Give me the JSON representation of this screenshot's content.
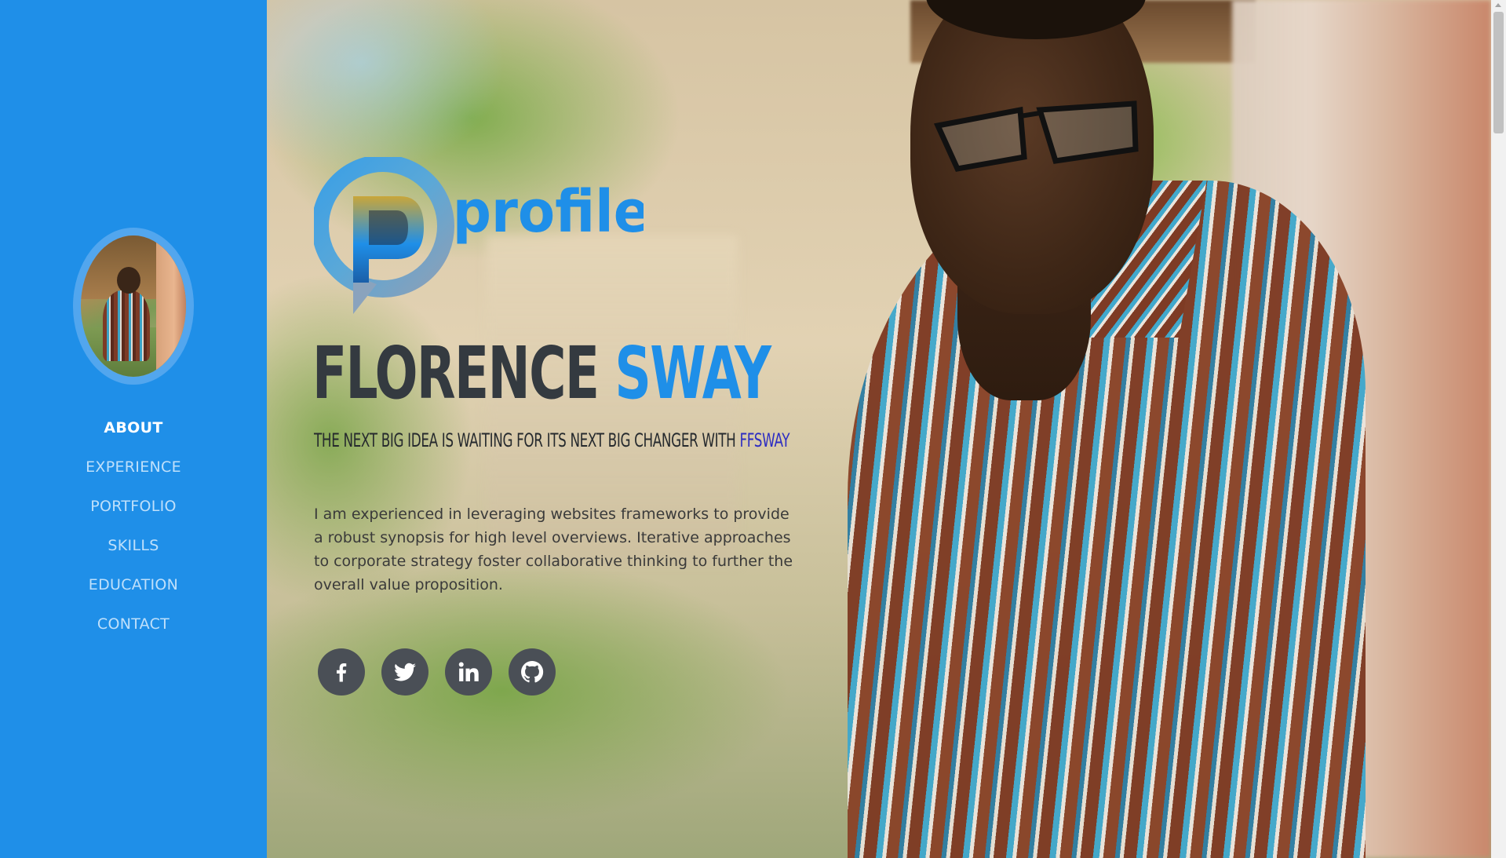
{
  "sidebar": {
    "avatar_alt": "Profile photo",
    "nav": [
      {
        "label": "ABOUT",
        "active": true
      },
      {
        "label": "EXPERIENCE",
        "active": false
      },
      {
        "label": "PORTFOLIO",
        "active": false
      },
      {
        "label": "SKILLS",
        "active": false
      },
      {
        "label": "EDUCATION",
        "active": false
      },
      {
        "label": "CONTACT",
        "active": false
      }
    ]
  },
  "hero": {
    "logo_text": "profile",
    "first_name": "FLORENCE",
    "last_name": "SWAY",
    "tagline": "THE NEXT BIG IDEA IS WAITING FOR ITS NEXT BIG CHANGER WITH",
    "tagline_brand": "FFSWAY",
    "bio": "I am experienced in leveraging websites frameworks to provide a robust synopsis for high level overviews. Iterative approaches to corporate strategy foster collaborative thinking to further the overall value proposition."
  },
  "socials": [
    {
      "name": "facebook",
      "icon": "facebook-icon"
    },
    {
      "name": "twitter",
      "icon": "twitter-icon"
    },
    {
      "name": "linkedin",
      "icon": "linkedin-icon"
    },
    {
      "name": "github",
      "icon": "github-icon"
    }
  ],
  "colors": {
    "sidebar": "#1f8fe8",
    "accent": "#1f8fe8",
    "nav_inactive": "#bfe0fb",
    "nav_active": "#ffffff",
    "heading_dark": "#343a40",
    "brand_link": "#2d2dc2",
    "social_bg": "#4a4f56"
  }
}
